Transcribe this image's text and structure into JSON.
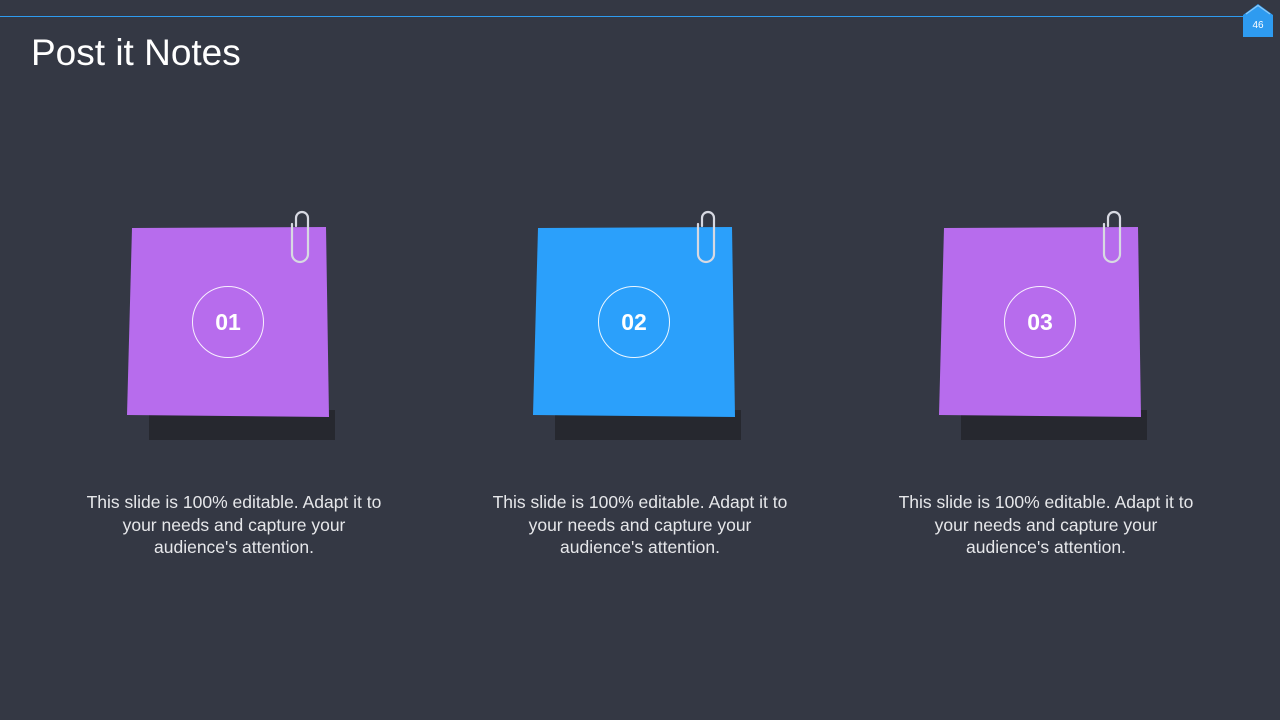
{
  "slide": {
    "title": "Post it Notes",
    "page_number": "46",
    "accent_color": "#2e9bf0"
  },
  "notes": [
    {
      "number": "01",
      "color": "#b76ced",
      "caption": "This slide is 100% editable. Adapt it to your needs and capture your audience's attention."
    },
    {
      "number": "02",
      "color": "#2ba0fb",
      "caption": "This slide is 100% editable. Adapt it to your needs and capture your audience's attention."
    },
    {
      "number": "03",
      "color": "#b76ced",
      "caption": "This slide is 100% editable. Adapt it to your needs and capture your audience's attention."
    }
  ],
  "icons": {
    "home": "home-icon",
    "clip": "paperclip-icon"
  }
}
